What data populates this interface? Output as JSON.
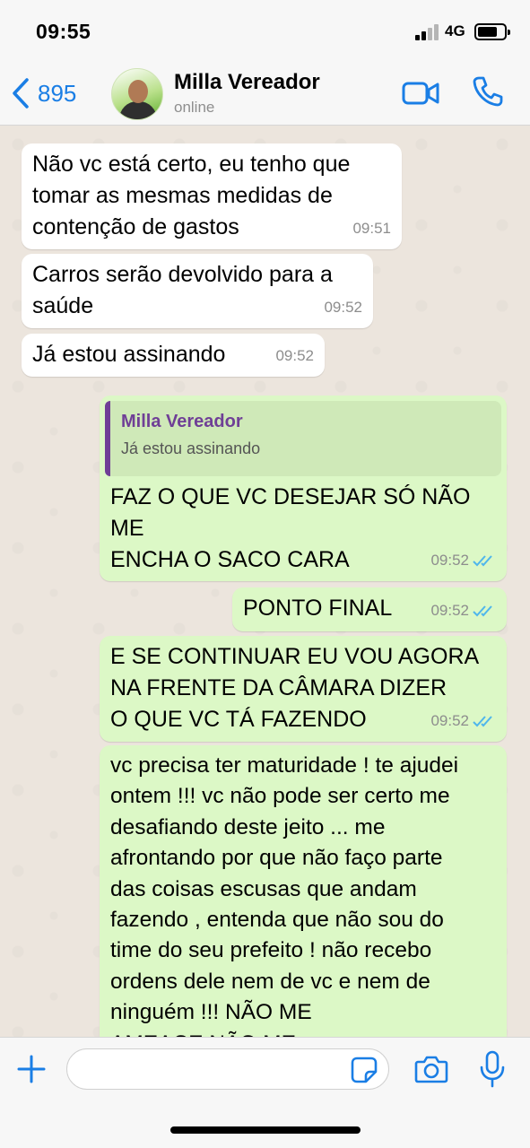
{
  "status_bar": {
    "time": "09:55",
    "network": "4G",
    "battery_level": 0.75
  },
  "header": {
    "back_count": "895",
    "contact_name": "Milla Vereador",
    "contact_status": "online"
  },
  "messages": [
    {
      "direction": "in",
      "text": "Não vc está certo, eu tenho que\ntomar as mesmas medidas de\ncontenção de gastos",
      "time": "09:51"
    },
    {
      "direction": "in",
      "text": "Carros serão devolvido para a\nsaúde",
      "time": "09:52"
    },
    {
      "direction": "in",
      "text": "Já estou assinando",
      "time": "09:52"
    },
    {
      "direction": "out",
      "quote": {
        "author": "Milla Vereador",
        "text": "Já estou assinando"
      },
      "text": "FAZ O QUE VC DESEJAR SÓ NÃO\nME\nENCHA O SACO CARA",
      "time": "09:52",
      "status": "read"
    },
    {
      "direction": "out",
      "text": "PONTO FINAL",
      "time": "09:52",
      "status": "read"
    },
    {
      "direction": "out",
      "text": "E SE CONTINUAR EU VOU AGORA\nNA FRENTE DA CÂMARA DIZER\nO QUE VC TÁ FAZENDO",
      "time": "09:52",
      "status": "read"
    },
    {
      "direction": "out",
      "text": "vc precisa ter maturidade ! te ajudei\nontem !!! vc não pode ser certo me\ndesafiando deste jeito ... me\nafrontando por que não faço parte\ndas coisas escusas que andam\nfazendo , entenda que não sou do\ntime do seu prefeito ! não recebo\nordens dele nem de vc e nem de\nninguém !!! NÃO ME\nAMEACE NÃO ME"
    }
  ],
  "colors": {
    "accent": "#1a7ee5",
    "outgoing": "#dcf8c6",
    "incoming": "#ffffff",
    "quote_bar": "#6f3f96",
    "read_ticks": "#4fb6ec"
  },
  "icons": [
    "chevron-left-icon",
    "video-camera-icon",
    "phone-icon",
    "plus-icon",
    "sticker-icon",
    "camera-icon",
    "microphone-icon"
  ]
}
